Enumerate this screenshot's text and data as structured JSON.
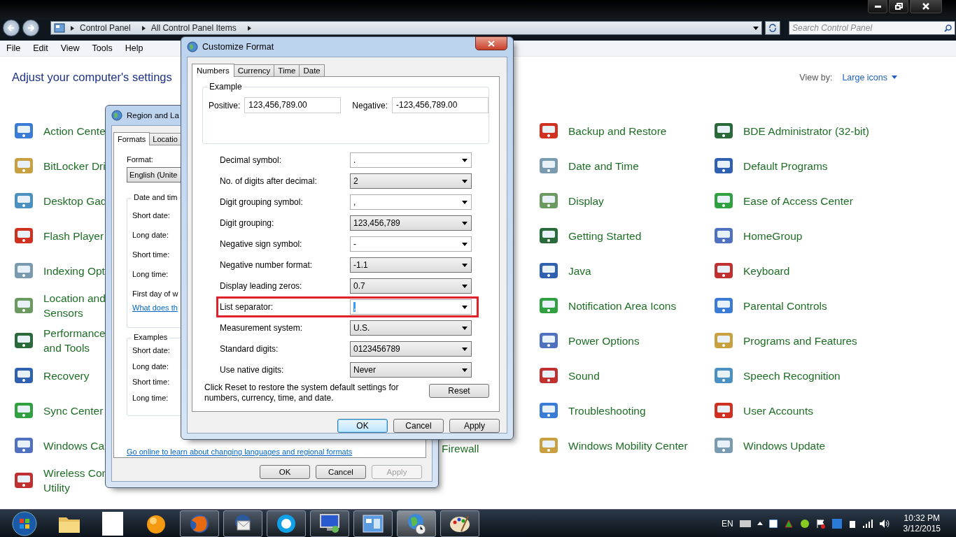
{
  "address_bar": {
    "breadcrumbs": [
      "Control Panel",
      "All Control Panel Items"
    ]
  },
  "search": {
    "placeholder": "Search Control Panel"
  },
  "menu": [
    "File",
    "Edit",
    "View",
    "Tools",
    "Help"
  ],
  "heading": "Adjust your computer's settings",
  "view_by": {
    "label": "View by:",
    "value": "Large icons"
  },
  "columns": [
    {
      "items": [
        "Action Cente",
        "BitLocker Dri",
        "Desktop Gad",
        "Flash Player",
        "Indexing Opt",
        "Location and\nSensors",
        "Performance\nand Tools",
        "Recovery",
        "Sync Center",
        "Windows Ca",
        "Wireless Con\nUtility"
      ]
    },
    {
      "items": [
        "Backup and Restore",
        "Date and Time",
        "Display",
        "Getting Started",
        "Java",
        "Notification Area Icons",
        "Power Options",
        "Sound",
        "Troubleshooting",
        "Windows Mobility Center"
      ]
    },
    {
      "items": [
        "BDE Administrator (32-bit)",
        "Default Programs",
        "Ease of Access Center",
        "HomeGroup",
        "Keyboard",
        "Parental Controls",
        "Programs and Features",
        "Speech Recognition",
        "User Accounts",
        "Windows Update"
      ]
    }
  ],
  "partial_item": {
    "label": "Firewall"
  },
  "region_dialog": {
    "title": "Region and La",
    "tabs": [
      {
        "label": "Formats",
        "selected": true
      },
      {
        "label": "Locatio",
        "selected": false
      }
    ],
    "format_label": "Format:",
    "format_value": "English (Unite",
    "date_group": {
      "legend": "Date and tim",
      "labels": [
        "Short date:",
        "Long date:",
        "Short time:",
        "Long time:",
        "First day of w"
      ],
      "link": "What does th"
    },
    "examples_group": {
      "legend": "Examples",
      "labels": [
        "Short date:",
        "Long date:",
        "Short time:",
        "Long time:"
      ]
    },
    "link": "Go online to learn about changing languages and regional formats",
    "buttons": [
      {
        "label": "OK",
        "disabled": false
      },
      {
        "label": "Cancel",
        "disabled": false
      },
      {
        "label": "Apply",
        "disabled": true
      }
    ]
  },
  "format_dialog": {
    "title": "Customize Format",
    "tabs": [
      {
        "label": "Numbers",
        "selected": true
      },
      {
        "label": "Currency",
        "selected": false
      },
      {
        "label": "Time",
        "selected": false
      },
      {
        "label": "Date",
        "selected": false
      }
    ],
    "example": {
      "legend": "Example",
      "positive_label": "Positive:",
      "positive": "123,456,789.00",
      "negative_label": "Negative:",
      "negative": "-123,456,789.00"
    },
    "settings": [
      {
        "label": "Decimal symbol:",
        "value": ".",
        "kind": "combo",
        "highlighted": false
      },
      {
        "label": "No. of digits after decimal:",
        "value": "2",
        "kind": "list",
        "highlighted": false
      },
      {
        "label": "Digit grouping symbol:",
        "value": ",",
        "kind": "combo",
        "highlighted": false
      },
      {
        "label": "Digit grouping:",
        "value": "123,456,789",
        "kind": "list",
        "highlighted": false
      },
      {
        "label": "Negative sign symbol:",
        "value": "-",
        "kind": "combo",
        "highlighted": false
      },
      {
        "label": "Negative number format:",
        "value": "-1.1",
        "kind": "list",
        "highlighted": false
      },
      {
        "label": "Display leading zeros:",
        "value": "0.7",
        "kind": "list",
        "highlighted": false
      },
      {
        "label": "List separator:",
        "value": ",",
        "kind": "combo",
        "highlighted": true
      },
      {
        "label": "Measurement system:",
        "value": "U.S.",
        "kind": "list",
        "highlighted": false
      },
      {
        "label": "Standard digits:",
        "value": "0123456789",
        "kind": "list",
        "highlighted": false
      },
      {
        "label": "Use native digits:",
        "value": "Never",
        "kind": "list",
        "highlighted": false
      }
    ],
    "reset_note": "Click Reset to restore the system default settings for numbers, currency, time, and date.",
    "reset_button": "Reset",
    "buttons": [
      {
        "label": "OK",
        "default": true
      },
      {
        "label": "Cancel",
        "default": false
      },
      {
        "label": "Apply",
        "default": false
      }
    ]
  },
  "taskbar": {
    "apps": [
      {
        "running": false,
        "selected": false
      },
      {
        "running": false,
        "selected": false
      },
      {
        "running": false,
        "selected": false
      },
      {
        "running": true,
        "selected": false
      },
      {
        "running": true,
        "selected": false
      },
      {
        "running": true,
        "selected": false
      },
      {
        "running": true,
        "selected": false
      },
      {
        "running": true,
        "selected": false
      },
      {
        "running": true,
        "selected": true
      },
      {
        "running": true,
        "selected": false
      }
    ],
    "language": "EN",
    "time": "10:32 PM",
    "date": "3/12/2015"
  }
}
